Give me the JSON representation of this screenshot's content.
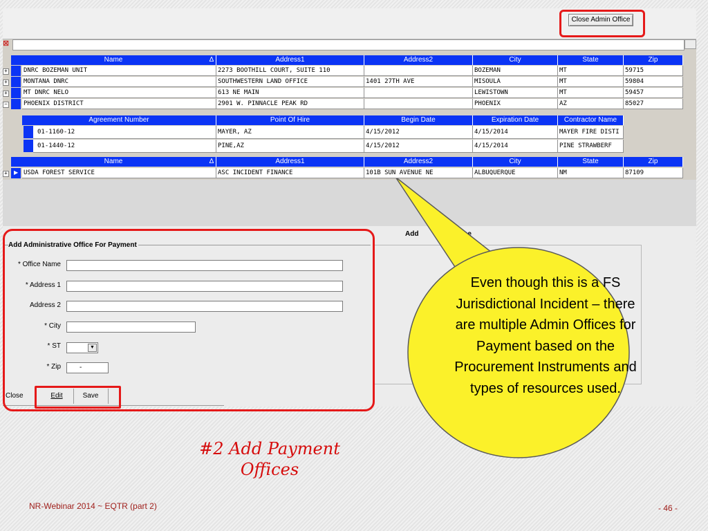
{
  "toolbar": {
    "close_admin_office": "Close Admin Office"
  },
  "grid": {
    "columns": [
      "Name",
      "Address1",
      "Address2",
      "City",
      "State",
      "Zip"
    ],
    "rows": [
      {
        "name": "DNRC BOZEMAN UNIT",
        "address1": "2273 BOOTHILL COURT, SUITE 110",
        "address2": "",
        "city": "BOZEMAN",
        "state": "MT",
        "zip": "59715"
      },
      {
        "name": "MONTANA DNRC",
        "address1": "SOUTHWESTERN LAND OFFICE",
        "address2": "1401 27TH AVE",
        "city": "MISOULA",
        "state": "MT",
        "zip": "59804"
      },
      {
        "name": "MT DNRC NELO",
        "address1": "613 NE MAIN",
        "address2": "",
        "city": "LEWISTOWN",
        "state": "MT",
        "zip": "59457"
      },
      {
        "name": "PHOENIX DISTRICT",
        "address1": "2901 W. PINNACLE PEAK RD",
        "address2": "",
        "city": "PHOENIX",
        "state": "AZ",
        "zip": "85027"
      }
    ],
    "sub_columns": [
      "Agreement Number",
      "Point Of Hire",
      "Begin Date",
      "Expiration Date",
      "Contractor Name"
    ],
    "sub_rows": [
      {
        "agreement": "01-1160-12",
        "hire": "MAYER, AZ",
        "begin": "4/15/2012",
        "expire": "4/15/2014",
        "contractor": "MAYER FIRE DISTI"
      },
      {
        "agreement": "01-1440-12",
        "hire": "PINE,AZ",
        "begin": "4/15/2012",
        "expire": "4/15/2014",
        "contractor": "PINE STRAWBERF"
      }
    ],
    "last_row": {
      "name": "USDA FOREST SERVICE",
      "address1": "ASC INCIDENT FINANCE",
      "address2": "101B SUN AVENUE NE",
      "city": "ALBUQUERQUE",
      "state": "NM",
      "zip": "87109"
    },
    "sort_indicator": "∆"
  },
  "form": {
    "header_partial": "Add",
    "header_tail": "ice",
    "group_title": "Add Administrative Office For Payment",
    "office_name_label": "* Office Name",
    "address1_label": "* Address 1",
    "address2_label": "Address 2",
    "city_label": "* City",
    "st_label": "* ST",
    "zip_label": "* Zip",
    "zip_value": "-",
    "close_label": "Close",
    "edit_label": "Edit",
    "save_label": "Save"
  },
  "callout": {
    "text": "Even though this is a FS Jurisdictional Incident – there are multiple Admin Offices for Payment based on the Procurement Instruments and types of resources used.",
    "color": "#fbf12a"
  },
  "slide": {
    "title_line1": "#2 Add  Payment",
    "title_line2": "Offices",
    "footer_left": "NR-Webinar 2014 ~ EQTR (part 2)",
    "page_number": "- 46 -"
  }
}
